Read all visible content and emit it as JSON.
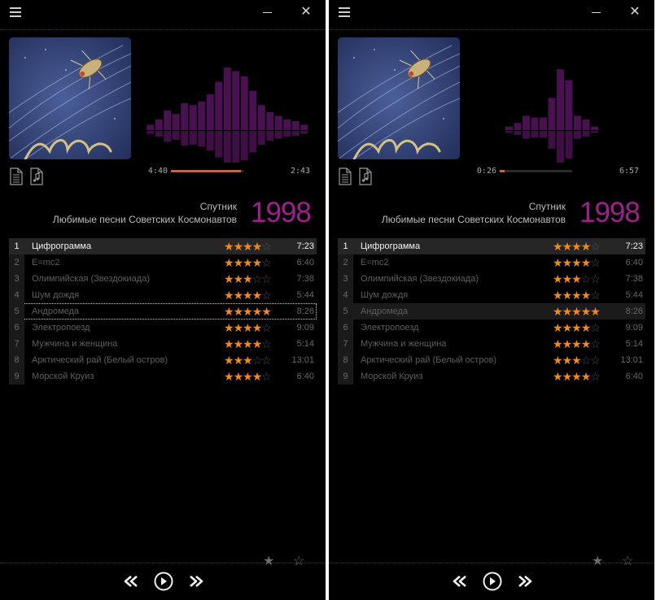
{
  "windows": [
    {
      "id": "left",
      "album": {
        "artist": "Спутник",
        "title": "Любимые песни Советских Космонавтов",
        "year": "1998"
      },
      "playback": {
        "elapsed": "4:40",
        "total": "2:43",
        "progress": 0.97
      },
      "highlight": {
        "active_index": 0,
        "focused_index": 4,
        "hover_index": -1
      },
      "viz_levels": [
        3,
        6,
        11,
        9,
        15,
        14,
        16,
        20,
        27,
        35,
        33,
        30,
        22,
        14,
        10,
        8,
        6,
        5,
        3
      ],
      "tracks": [
        {
          "num": "1",
          "title": "Цифрограмма",
          "rating": 4,
          "duration": "7:23"
        },
        {
          "num": "2",
          "title": "E=mc2",
          "rating": 4,
          "duration": "6:40"
        },
        {
          "num": "3",
          "title": "Олимпийская (Звездокиада)",
          "rating": 3,
          "duration": "7:38"
        },
        {
          "num": "4",
          "title": "Шум дождя",
          "rating": 4,
          "duration": "5:44"
        },
        {
          "num": "5",
          "title": "Андромеда",
          "rating": 5,
          "duration": "8:26"
        },
        {
          "num": "6",
          "title": "Электропоезд",
          "rating": 4,
          "duration": "9:09"
        },
        {
          "num": "7",
          "title": "Мужчина и женщина",
          "rating": 4,
          "duration": "5:14"
        },
        {
          "num": "8",
          "title": "Арктический рай (Белый остров)",
          "rating": 3,
          "duration": "13:01"
        },
        {
          "num": "9",
          "title": "Морской Круиз",
          "rating": 4,
          "duration": "6:40"
        }
      ]
    },
    {
      "id": "right",
      "album": {
        "artist": "Спутник",
        "title": "Любимые песни Советских Космонавтов",
        "year": "1998"
      },
      "playback": {
        "elapsed": "0:26",
        "total": "6:57",
        "progress": 0.07
      },
      "highlight": {
        "active_index": 0,
        "focused_index": -1,
        "hover_index": 4
      },
      "viz_levels": [
        0,
        0,
        2,
        4,
        8,
        7,
        7,
        18,
        34,
        28,
        8,
        6,
        2,
        0,
        0,
        0
      ],
      "tracks": [
        {
          "num": "1",
          "title": "Цифрограмма",
          "rating": 4,
          "duration": "7:23"
        },
        {
          "num": "2",
          "title": "E=mc2",
          "rating": 4,
          "duration": "6:40"
        },
        {
          "num": "3",
          "title": "Олимпийская (Звездокиада)",
          "rating": 3,
          "duration": "7:38"
        },
        {
          "num": "4",
          "title": "Шум дождя",
          "rating": 4,
          "duration": "5:44"
        },
        {
          "num": "5",
          "title": "Андромеда",
          "rating": 5,
          "duration": "8:26"
        },
        {
          "num": "6",
          "title": "Электропоезд",
          "rating": 4,
          "duration": "9:09"
        },
        {
          "num": "7",
          "title": "Мужчина и женщина",
          "rating": 4,
          "duration": "5:14"
        },
        {
          "num": "8",
          "title": "Арктический рай (Белый остров)",
          "rating": 3,
          "duration": "13:01"
        },
        {
          "num": "9",
          "title": "Морской Круиз",
          "rating": 4,
          "duration": "6:40"
        }
      ]
    }
  ],
  "icons": {
    "menu": "hamburger-menu-icon",
    "minimize": "minimize-icon",
    "close": "close-icon",
    "document": "document-icon",
    "music_file": "music-file-icon",
    "rate_filled": "star-filled-icon",
    "rate_empty": "star-outline-icon",
    "prev": "rewind-icon",
    "play": "play-icon",
    "next": "fast-forward-icon"
  },
  "glyphs": {
    "close": "✕",
    "star_filled": "★",
    "star_empty": "☆"
  },
  "colors": {
    "background": "#000000",
    "accent_orange": "#ef8a1f",
    "progress_orange": "#e85a22",
    "year_purple": "#a0218e",
    "viz_purple": "#4a1150"
  }
}
